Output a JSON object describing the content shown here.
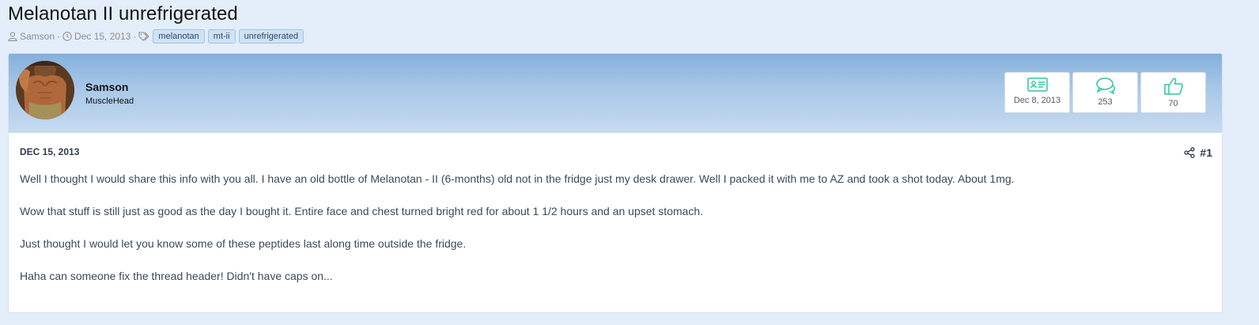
{
  "thread": {
    "title": "Melanotan II unrefrigerated",
    "author": "Samson",
    "date": "Dec 15, 2013",
    "tags": [
      "melanotan",
      "mt-ii",
      "unrefrigerated"
    ]
  },
  "post": {
    "username": "Samson",
    "user_title": "MuscleHead",
    "stats": [
      {
        "icon": "id-card-icon",
        "value": "Dec 8, 2013"
      },
      {
        "icon": "messages-icon",
        "value": "253"
      },
      {
        "icon": "thumbs-up-icon",
        "value": "70"
      }
    ],
    "date": "DEC 15, 2013",
    "number": "#1",
    "paragraphs": [
      "Well I thought I would share this info with you all. I have an old bottle of Melanotan - II (6-months) old not in the fridge just my desk drawer. Well I packed it with me to AZ and took a shot today. About 1mg.",
      "Wow that stuff is still just as good as the day I bought it. Entire face and chest turned bright red for about 1 1/2 hours and an upset stomach.",
      "Just thought I would let you know some of these peptides last along time outside the fridge.",
      "Haha can someone fix the thread header! Didn't have caps on..."
    ]
  },
  "colors": {
    "accent_icon": "#2ec79a",
    "header_gradient_top": "#84b0dd",
    "header_gradient_bottom": "#c6dbf0",
    "page_background": "#e3eefa"
  }
}
